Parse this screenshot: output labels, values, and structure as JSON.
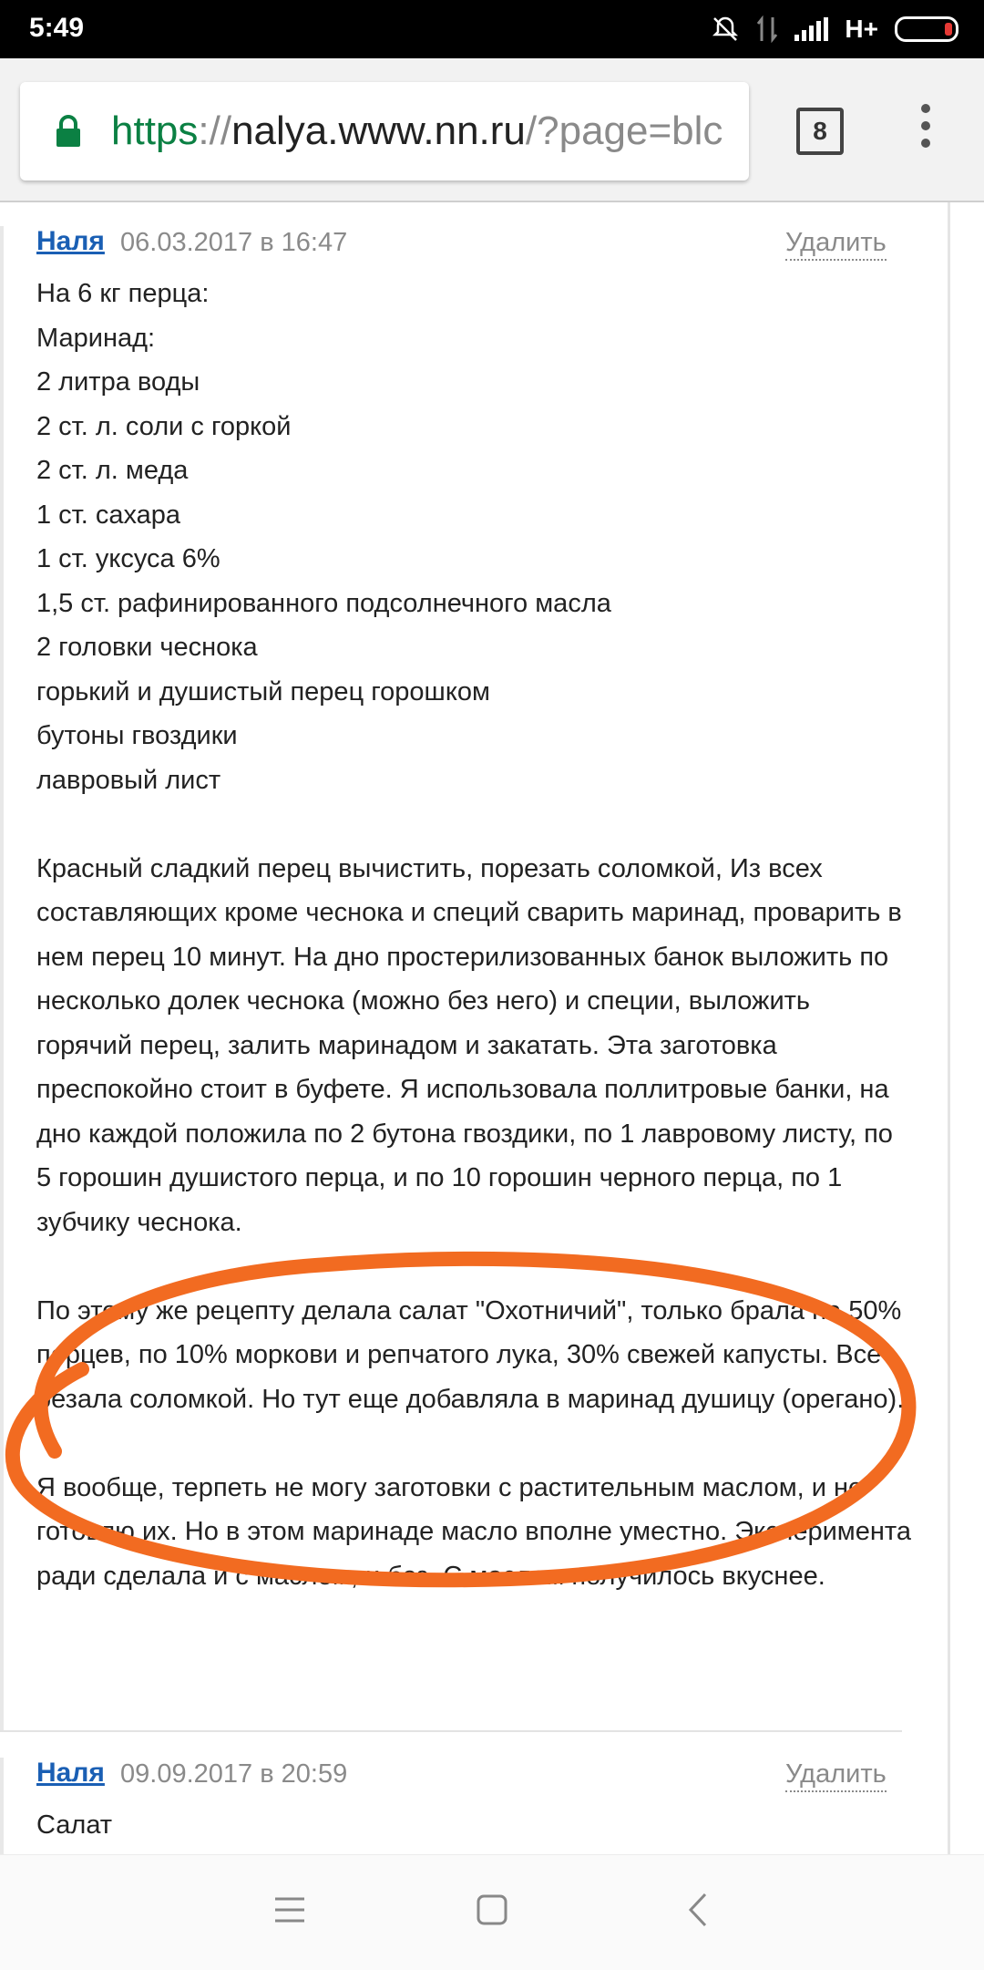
{
  "status_bar": {
    "time": "5:49",
    "network": "H+",
    "icons": [
      "no-notification-icon",
      "data-transfer-icon",
      "signal-icon",
      "battery-icon"
    ]
  },
  "browser": {
    "url_scheme": "https",
    "url_sep": "://",
    "url_host": "nalya.www.nn.ru",
    "url_rest": "/?page=blc",
    "tab_count": "8",
    "accent_color": "#0b8043"
  },
  "comments": [
    {
      "author": "Наля",
      "date": "06.03.2017 в 16:47",
      "delete_label": "Удалить",
      "text": "На 6 кг перца:\nМаринад:\n2 литра воды\n2 ст. л. соли с горкой\n2 ст. л. меда\n1 ст. сахара\n1 ст. уксуса 6%\n1,5 ст. рафинированного подсолнечного масла\n2 головки чеснока\nгорький и душистый перец горошком\nбутоны гвоздики\nлавровый лист\n\nКрасный сладкий перец вычистить, порезать соломкой, Из всех составляющих кроме чеснока и специй сварить маринад, проварить в нем перец 10 минут. На дно простерилизованных банок выложить по несколько долек чеснока (можно без него) и специи, выложить горячий перец, залить маринадом и закатать. Эта заготовка преспокойно стоит в буфете. Я использовала поллитровые банки, на дно каждой положила по 2 бутона гвоздики, по 1 лавровому листу, по 5 горошин душистого перца, и по 10 горошин черного перца, по 1 зубчику чеснока.\n\nПо этому же рецепту делала салат \"Охотничий\", только брала на 50% перцев, по 10% моркови и репчатого лука, 30% свежей капусты. Все резала соломкой. Но тут еще добавляла в маринад душицу (орегано).\n\nЯ вообще, терпеть не могу заготовки с растительным маслом, и не готовлю их. Но в этом маринаде масло вполне уместно. Эксперимента ради сделала и с маслом, и без. С маслом получилось вкуснее."
    },
    {
      "author": "Наля",
      "date": "09.09.2017 в 20:59",
      "delete_label": "Удалить",
      "text": "Салат"
    }
  ],
  "annotation_color": "#f26b21",
  "nav": {
    "icons": [
      "menu-icon",
      "home-icon",
      "back-icon"
    ]
  }
}
